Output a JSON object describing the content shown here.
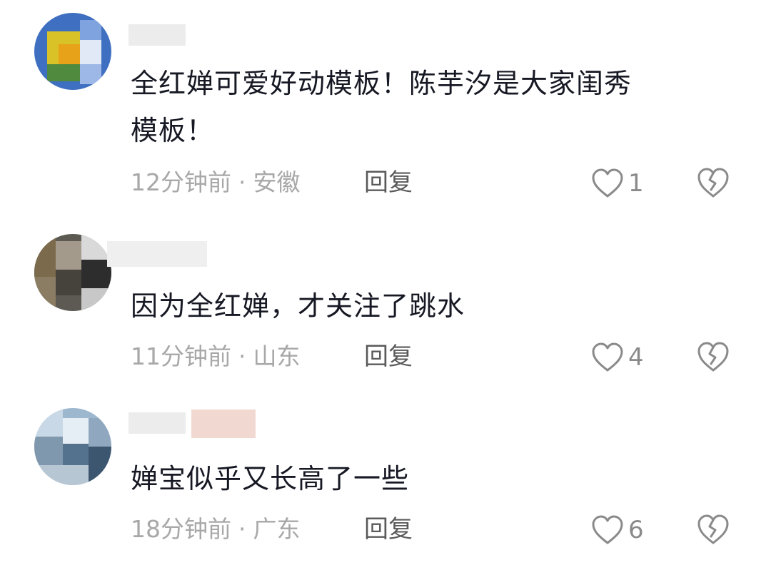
{
  "comments": [
    {
      "username": "",
      "text_lines": [
        "全红婵可爱好动模板！陈芋汐是大家闺秀",
        "模板！"
      ],
      "time": "12分钟前",
      "location": "安徽",
      "reply_label": "回复",
      "likes": "1"
    },
    {
      "username": "",
      "text_lines": [
        "因为全红婵，才关注了跳水"
      ],
      "time": "11分钟前",
      "location": "山东",
      "reply_label": "回复",
      "likes": "4"
    },
    {
      "username": "",
      "text_lines": [
        "婵宝似乎又长高了一些"
      ],
      "time": "18分钟前",
      "location": "广东",
      "reply_label": "回复",
      "likes": "6"
    }
  ],
  "meta_separator": "·",
  "icons": {
    "like": "heart-outline-icon",
    "dislike": "broken-heart-icon"
  },
  "colors": {
    "text": "#161823",
    "meta": "#a8a8a8",
    "reply": "#5a5a5a",
    "icon": "#8a8a8a"
  }
}
